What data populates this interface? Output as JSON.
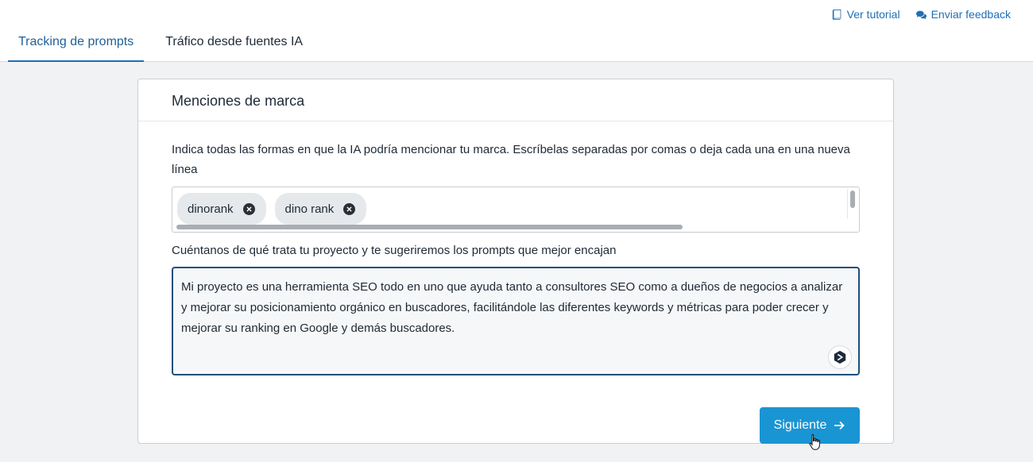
{
  "header": {
    "tutorial_label": "Ver tutorial",
    "feedback_label": "Enviar feedback",
    "tabs": [
      {
        "label": "Tracking de prompts",
        "active": true
      },
      {
        "label": "Tráfico desde fuentes IA",
        "active": false
      }
    ]
  },
  "card": {
    "title": "Menciones de marca",
    "brand_instructions": "Indica todas las formas en que la IA podría mencionar tu marca. Escríbelas separadas por comas o deja cada una en una nueva línea",
    "tags": [
      "dinorank",
      "dino rank"
    ],
    "project_label": "Cuéntanos de qué trata tu proyecto y te sugeriremos los prompts que mejor encajan",
    "project_description": "Mi proyecto es una herramienta SEO todo en uno que ayuda tanto a consultores SEO como a dueños de negocios a analizar y mejorar su posicionamiento orgánico en buscadores, facilitándole las diferentes keywords y métricas para poder crecer y mejorar su ranking en Google y demás buscadores.",
    "next_label": "Siguiente"
  },
  "colors": {
    "accent": "#1f6fb5",
    "button": "#1a95d3",
    "textarea_border": "#1f4f7c"
  },
  "icons": [
    "book-icon",
    "comments-icon",
    "close-circle-icon",
    "ai-assistant-icon",
    "arrow-right-icon",
    "hand-cursor-icon"
  ]
}
